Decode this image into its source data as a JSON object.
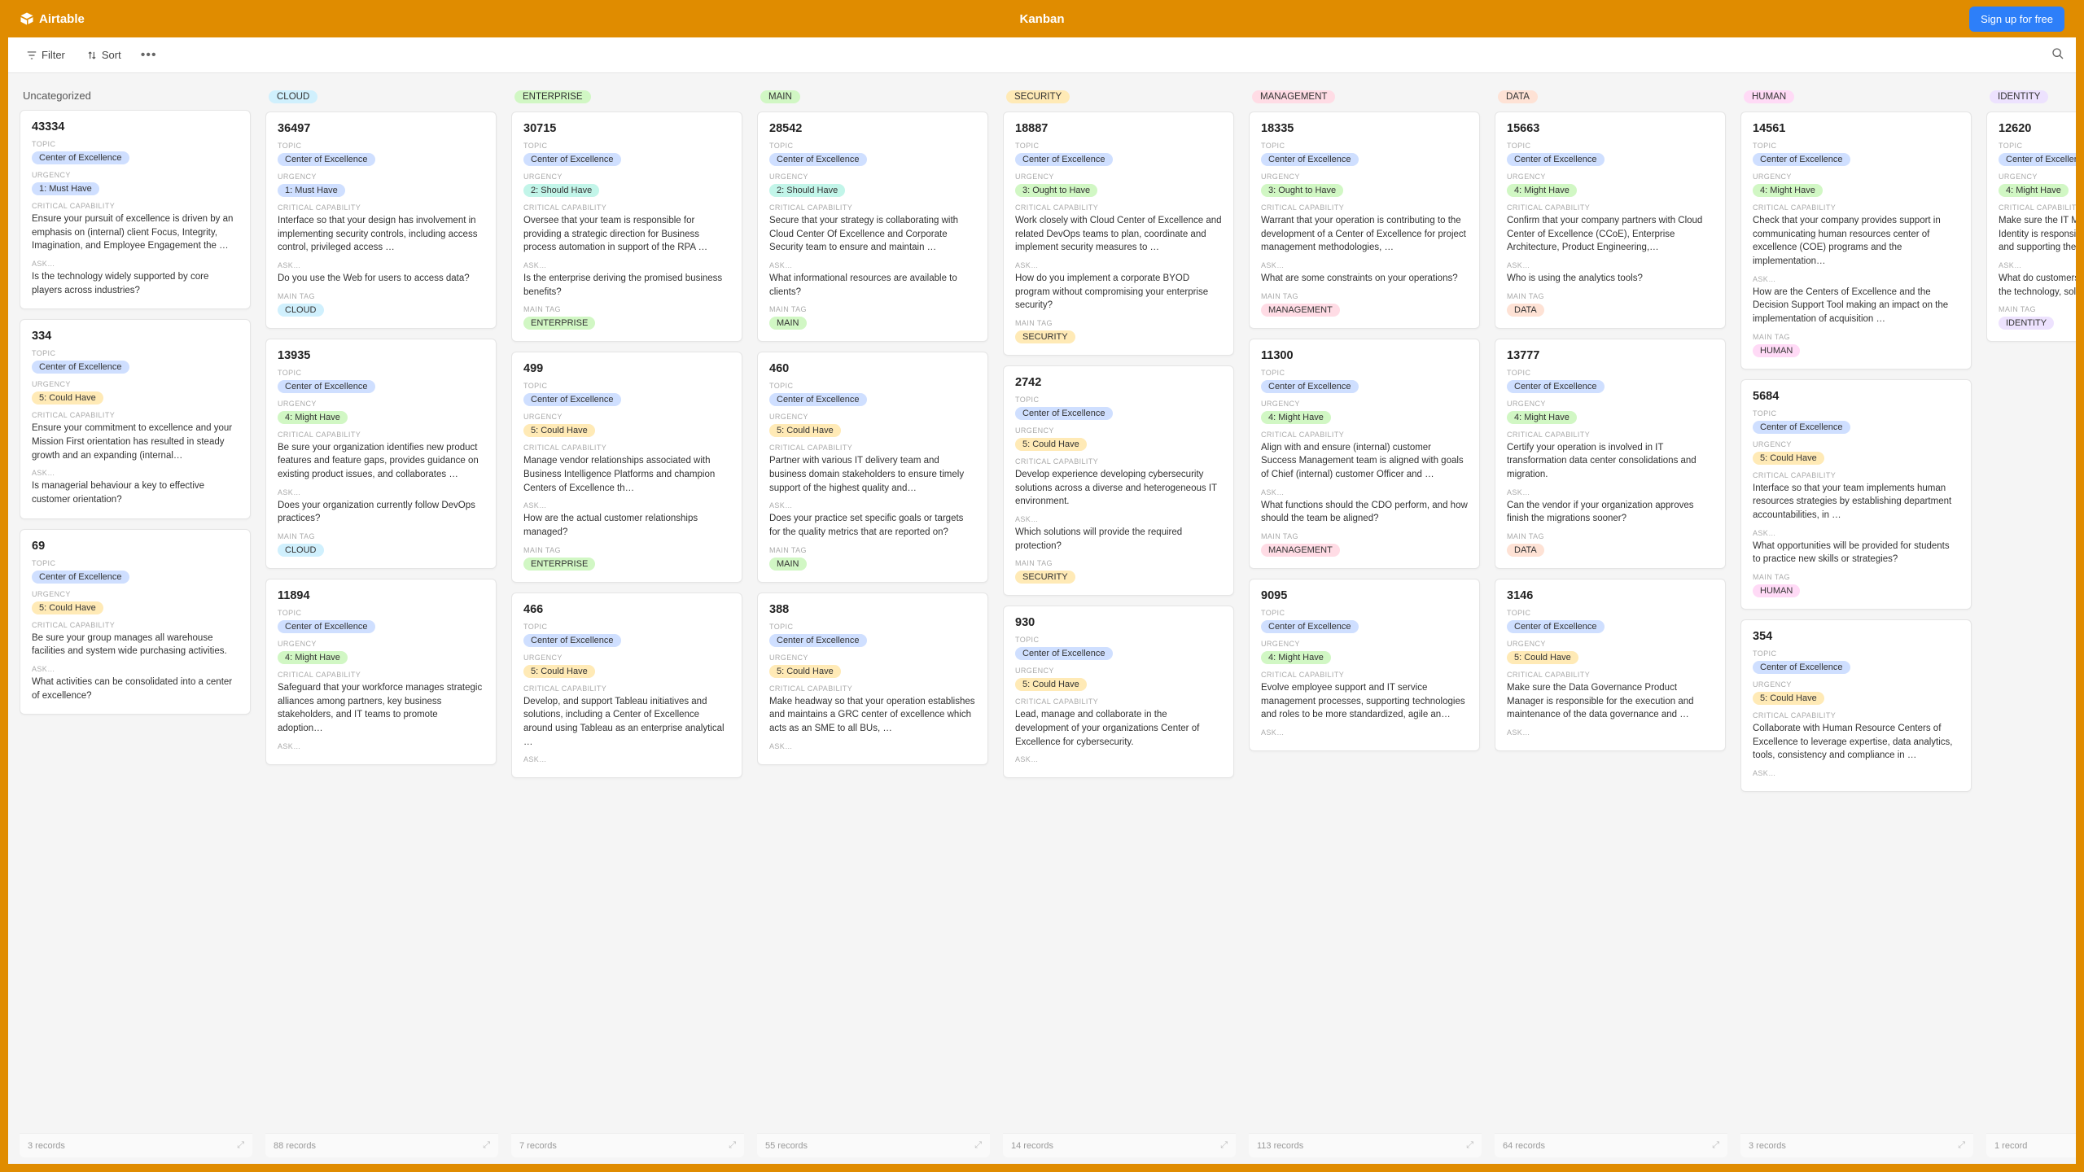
{
  "header": {
    "logo_text": "Airtable",
    "title": "Kanban",
    "signup": "Sign up for free"
  },
  "toolbar": {
    "filter": "Filter",
    "sort": "Sort"
  },
  "labels": {
    "topic": "TOPIC",
    "urgency": "URGENCY",
    "critical": "CRITICAL CAPABILITY",
    "ask": "ASK…",
    "maintag": "MAIN TAG"
  },
  "tag_colors": {
    "CLOUD": "c-cyan",
    "ENTERPRISE": "c-green",
    "MAIN": "c-green",
    "SECURITY": "c-yellow",
    "MANAGEMENT": "c-red",
    "DATA": "c-orange",
    "HUMAN": "c-pink",
    "IDENTITY": "c-purple"
  },
  "urgency_colors": {
    "1: Must Have": "c-blue",
    "2: Should Have": "c-teal",
    "3: Ought to Have": "c-green",
    "4: Might Have": "c-green",
    "5: Could Have": "c-yellow"
  },
  "topic_chip": "Center of Excellence",
  "columns": [
    {
      "name": "Uncategorized",
      "name_plain": true,
      "footer": "3 records",
      "cards": [
        {
          "id": "43334",
          "urgency": "1: Must Have",
          "critical": "Ensure your pursuit of excellence is driven by an emphasis on (internal) client Focus, Integrity, Imagination, and Employee Engagement the …",
          "ask": "Is the technology widely supported by core players across industries?"
        },
        {
          "id": "334",
          "urgency": "5: Could Have",
          "critical": "Ensure your commitment to excellence and your Mission First orientation has resulted in steady growth and an expanding (internal…",
          "ask": "Is managerial behaviour a key to effective customer orientation?"
        },
        {
          "id": "69",
          "urgency": "5: Could Have",
          "critical": "Be sure your group manages all warehouse facilities and system wide purchasing activities.",
          "ask": "What activities can be consolidated into a center of excellence?"
        }
      ]
    },
    {
      "name": "CLOUD",
      "footer": "88 records",
      "cards": [
        {
          "id": "36497",
          "urgency": "1: Must Have",
          "critical": "Interface so that your design has involvement in implementing security controls, including access control, privileged access …",
          "ask": "Do you use the Web for users to access data?",
          "maintag": "CLOUD"
        },
        {
          "id": "13935",
          "urgency": "4: Might Have",
          "critical": "Be sure your organization identifies new product features and feature gaps, provides guidance on existing product issues, and collaborates …",
          "ask": "Does your organization currently follow DevOps practices?",
          "maintag": "CLOUD"
        },
        {
          "id": "11894",
          "urgency": "4: Might Have",
          "critical": "Safeguard that your workforce manages strategic alliances among partners, key business stakeholders, and IT teams to promote adoption…",
          "ask": ""
        }
      ]
    },
    {
      "name": "ENTERPRISE",
      "footer": "7 records",
      "cards": [
        {
          "id": "30715",
          "urgency": "2: Should Have",
          "critical": "Oversee that your team is responsible for providing a strategic direction for Business process automation in support of the RPA …",
          "ask": "Is the enterprise deriving the promised business benefits?",
          "maintag": "ENTERPRISE"
        },
        {
          "id": "499",
          "urgency": "5: Could Have",
          "critical": "Manage vendor relationships associated with Business Intelligence Platforms and champion Centers of Excellence th…",
          "ask": "How are the actual customer relationships managed?",
          "maintag": "ENTERPRISE"
        },
        {
          "id": "466",
          "urgency": "5: Could Have",
          "critical": "Develop, and support Tableau initiatives and solutions, including a Center of Excellence around using Tableau as an enterprise analytical …",
          "ask": ""
        }
      ]
    },
    {
      "name": "MAIN",
      "footer": "55 records",
      "cards": [
        {
          "id": "28542",
          "urgency": "2: Should Have",
          "critical": "Secure that your strategy is collaborating with Cloud Center Of Excellence and Corporate Security team to ensure and maintain …",
          "ask": "What informational resources are available to clients?",
          "maintag": "MAIN"
        },
        {
          "id": "460",
          "urgency": "5: Could Have",
          "critical": "Partner with various IT delivery team and business domain stakeholders to ensure timely support of the highest quality and…",
          "ask": "Does your practice set specific goals or targets for the quality metrics that are reported on?",
          "maintag": "MAIN"
        },
        {
          "id": "388",
          "urgency": "5: Could Have",
          "critical": "Make headway so that your operation establishes and maintains a GRC center of excellence which acts as an SME to all BUs, …",
          "ask": ""
        }
      ]
    },
    {
      "name": "SECURITY",
      "footer": "14 records",
      "cards": [
        {
          "id": "18887",
          "urgency": "3: Ought to Have",
          "critical": "Work closely with Cloud Center of Excellence and related DevOps teams to plan, coordinate and implement security measures to …",
          "ask": "How do you implement a corporate BYOD program without compromising your enterprise security?",
          "maintag": "SECURITY"
        },
        {
          "id": "2742",
          "urgency": "5: Could Have",
          "critical": "Develop experience developing cybersecurity solutions across a diverse and heterogeneous IT environment.",
          "ask": "Which solutions will provide the required protection?",
          "maintag": "SECURITY"
        },
        {
          "id": "930",
          "urgency": "5: Could Have",
          "critical": "Lead, manage and collaborate in the development of your organizations Center of Excellence for cybersecurity.",
          "ask": ""
        }
      ]
    },
    {
      "name": "MANAGEMENT",
      "footer": "113 records",
      "cards": [
        {
          "id": "18335",
          "urgency": "3: Ought to Have",
          "critical": "Warrant that your operation is contributing to the development of a Center of Excellence for project management methodologies, …",
          "ask": "What are some constraints on your operations?",
          "maintag": "MANAGEMENT"
        },
        {
          "id": "11300",
          "urgency": "4: Might Have",
          "critical": "Align with and ensure (internal) customer Success Management team is aligned with goals of Chief (internal) customer Officer and …",
          "ask": "What functions should the CDO perform, and how should the team be aligned?",
          "maintag": "MANAGEMENT"
        },
        {
          "id": "9095",
          "urgency": "4: Might Have",
          "critical": "Evolve employee support and IT service management processes, supporting technologies and roles to be more standardized, agile an…",
          "ask": ""
        }
      ]
    },
    {
      "name": "DATA",
      "footer": "64 records",
      "cards": [
        {
          "id": "15663",
          "urgency": "4: Might Have",
          "critical": "Confirm that your company partners with Cloud Center of Excellence (CCoE), Enterprise Architecture, Product Engineering,…",
          "ask": "Who is using the analytics tools?",
          "maintag": "DATA"
        },
        {
          "id": "13777",
          "urgency": "4: Might Have",
          "critical": "Certify your operation is involved in IT transformation data center consolidations and migration.",
          "ask": "Can the vendor if your organization approves finish the migrations sooner?",
          "maintag": "DATA"
        },
        {
          "id": "3146",
          "urgency": "5: Could Have",
          "critical": "Make sure the Data Governance Product Manager is responsible for the execution and maintenance of the data governance and …",
          "ask": ""
        }
      ]
    },
    {
      "name": "HUMAN",
      "footer": "3 records",
      "cards": [
        {
          "id": "14561",
          "urgency": "4: Might Have",
          "critical": "Check that your company provides support in communicating human resources center of excellence (COE) programs and the implementation…",
          "ask": "How are the Centers of Excellence and the Decision Support Tool making an impact on the implementation of acquisition …",
          "maintag": "HUMAN"
        },
        {
          "id": "5684",
          "urgency": "5: Could Have",
          "critical": "Interface so that your team implements human resources strategies by establishing department accountabilities, in …",
          "ask": "What opportunities will be provided for students to practice new skills or strategies?",
          "maintag": "HUMAN"
        },
        {
          "id": "354",
          "urgency": "5: Could Have",
          "critical": "Collaborate with Human Resource Centers of Excellence to leverage expertise, data analytics, tools, consistency and compliance in …",
          "ask": ""
        }
      ]
    },
    {
      "name": "IDENTITY",
      "footer": "1 record",
      "cards": [
        {
          "id": "12620",
          "urgency": "4: Might Have",
          "critical": "Make sure the IT Manager, (internal) customer Identity is responsible for planning, developing and supporting the (internal) cust…",
          "ask": "What do customers, prospects, and users think of the technology, solutions, and vendors?",
          "maintag": "IDENTITY"
        }
      ]
    }
  ]
}
